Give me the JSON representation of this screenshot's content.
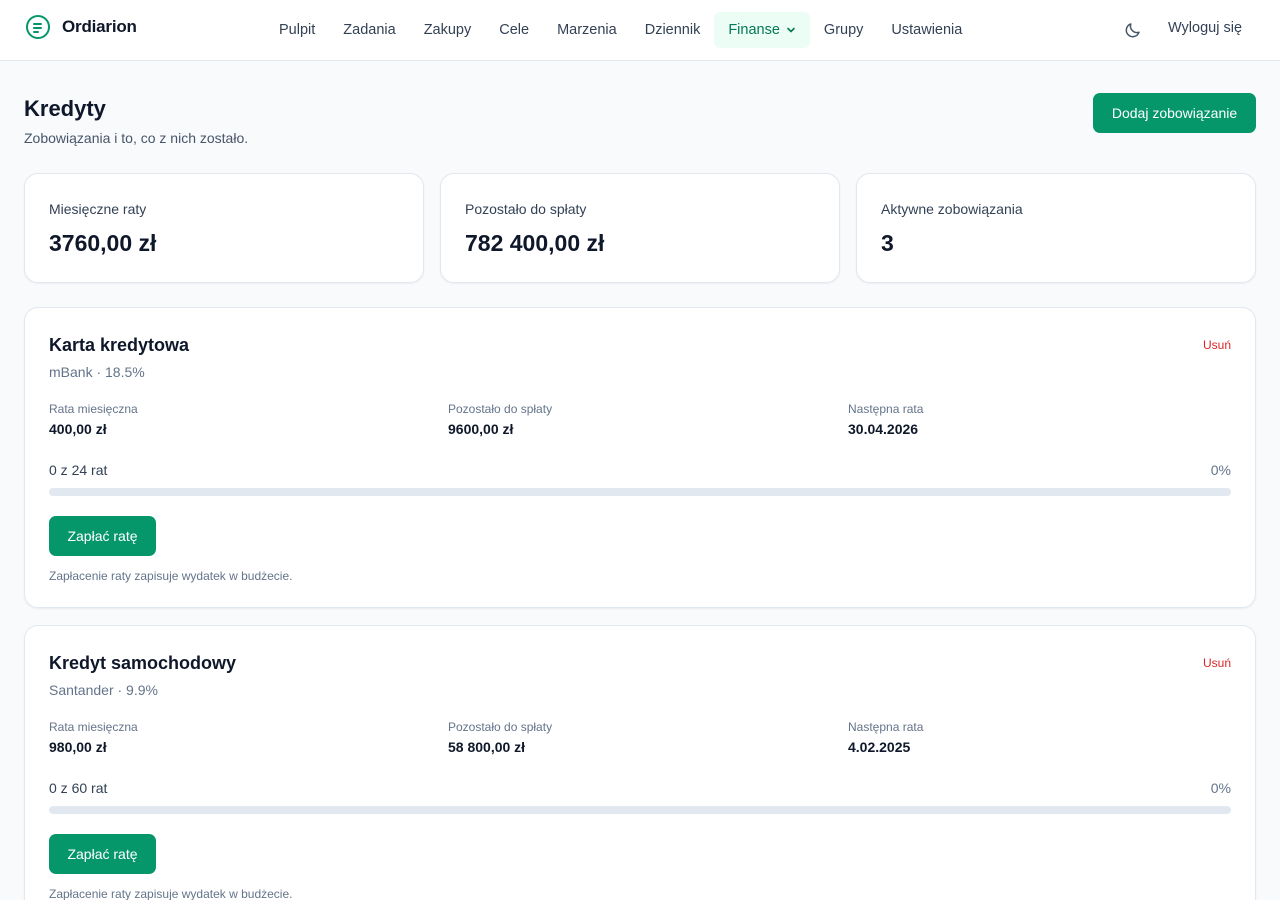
{
  "brand": {
    "name": "Ordiarion"
  },
  "nav": {
    "items": [
      "Pulpit",
      "Zadania",
      "Zakupy",
      "Cele",
      "Marzenia",
      "Dziennik",
      "Finanse",
      "Grupy",
      "Ustawienia"
    ],
    "active": "Finanse",
    "logout": "Wyloguj się"
  },
  "page": {
    "title": "Kredyty",
    "subtitle": "Zobowiązania i to, co z nich zostało.",
    "add_button": "Dodaj zobowiązanie"
  },
  "summary": {
    "monthly": {
      "label": "Miesięczne raty",
      "value": "3760,00 zł"
    },
    "remaining": {
      "label": "Pozostało do spłaty",
      "value": "782 400,00 zł"
    },
    "active": {
      "label": "Aktywne zobowiązania",
      "value": "3"
    }
  },
  "labels": {
    "installment": "Rata miesięczna",
    "remaining": "Pozostało do spłaty",
    "next": "Następna rata",
    "delete": "Usuń",
    "pay": "Zapłać ratę",
    "note": "Zapłacenie raty zapisuje wydatek w budżecie."
  },
  "loans": [
    {
      "name": "Karta kredytowa",
      "sub": "mBank · 18.5%",
      "installment": "400,00 zł",
      "remaining": "9600,00 zł",
      "next": "30.04.2026",
      "progress_text": "0 z 24 rat",
      "progress_pct": "0%",
      "progress": 0
    },
    {
      "name": "Kredyt samochodowy",
      "sub": "Santander · 9.9%",
      "installment": "980,00 zł",
      "remaining": "58 800,00 zł",
      "next": "4.02.2025",
      "progress_text": "0 z 60 rat",
      "progress_pct": "0%",
      "progress": 0
    }
  ],
  "colors": {
    "accent": "#059669",
    "danger": "#dc2626",
    "active_nav_bg": "#ecfdf5"
  }
}
